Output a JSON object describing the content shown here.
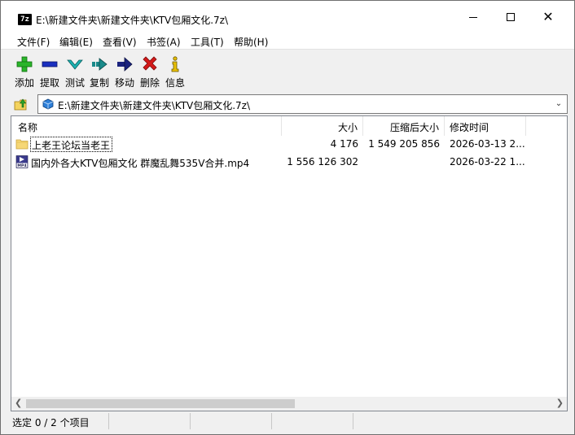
{
  "window": {
    "app_icon_text": "7z",
    "title": "E:\\新建文件夹\\新建文件夹\\KTV包厢文化.7z\\"
  },
  "menu": [
    {
      "label": "文件(F)"
    },
    {
      "label": "编辑(E)"
    },
    {
      "label": "查看(V)"
    },
    {
      "label": "书签(A)"
    },
    {
      "label": "工具(T)"
    },
    {
      "label": "帮助(H)"
    }
  ],
  "toolbar": [
    {
      "label": "添加",
      "icon": "plus-icon",
      "color": "#2ab52a"
    },
    {
      "label": "提取",
      "icon": "minus-icon",
      "color": "#1a2fbf"
    },
    {
      "label": "测试",
      "icon": "check-icon",
      "color": "#1ab2b2"
    },
    {
      "label": "复制",
      "icon": "copy-arrow-icon",
      "color": "#1a8a8a"
    },
    {
      "label": "移动",
      "icon": "move-arrow-icon",
      "color": "#1a237e"
    },
    {
      "label": "删除",
      "icon": "delete-icon",
      "color": "#d41a1a"
    },
    {
      "label": "信息",
      "icon": "info-icon",
      "color": "#c9a400"
    }
  ],
  "address": {
    "path": "E:\\新建文件夹\\新建文件夹\\KTV包厢文化.7z\\"
  },
  "columns": [
    {
      "label": "名称"
    },
    {
      "label": "大小"
    },
    {
      "label": "压缩后大小"
    },
    {
      "label": "修改时间"
    }
  ],
  "rows": [
    {
      "name": "上老王论坛当老王",
      "size": "4 176",
      "packed": "1 549 205 856",
      "modified": "2026-03-13 2...",
      "type": "folder"
    },
    {
      "name": "国内外各大KTV包厢文化 群魔乱舞535V合并.mp4",
      "size": "1 556 126 302",
      "packed": "",
      "modified": "2026-03-22 1...",
      "type": "mp4"
    }
  ],
  "mp4_icon_text": "MP4",
  "status": {
    "text": "选定 0 / 2 个项目"
  }
}
